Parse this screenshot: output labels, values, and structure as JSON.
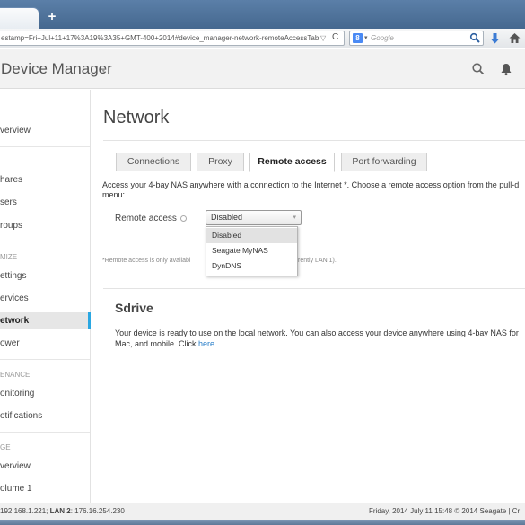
{
  "browser": {
    "newtab_label": "+",
    "url": "estamp=Fri+Jul+11+17%3A19%3A35+GMT-400+2014#device_manager-network-remoteAccessTab",
    "url_dropdown": "▽",
    "reload_glyph": "C",
    "search_engine_badge": "8",
    "search_engine_dropdown": "▾",
    "search_placeholder": "Google",
    "icons": [
      "search-icon",
      "download-icon",
      "home-icon"
    ]
  },
  "header": {
    "title": "Device Manager",
    "title_caret": "▾",
    "icons": [
      "search-icon",
      "bell-icon"
    ],
    "accent_color": "#2aa7e2"
  },
  "sidebar": {
    "items": [
      {
        "label": "verview"
      },
      {
        "label": "hares"
      },
      {
        "label": "sers"
      },
      {
        "label": "roups"
      },
      {
        "label": "ettings"
      },
      {
        "label": "ervices"
      },
      {
        "label": "etwork"
      },
      {
        "label": "ower"
      },
      {
        "label": "onitoring"
      },
      {
        "label": "otifications"
      },
      {
        "label": "verview"
      },
      {
        "label": "olume 1"
      }
    ],
    "section_headings": [
      "MIZE",
      "ENANCE",
      "GE"
    ]
  },
  "main": {
    "title": "Network",
    "tabs": [
      {
        "label": "Connections"
      },
      {
        "label": "Proxy"
      },
      {
        "label": "Remote access"
      },
      {
        "label": "Port forwarding"
      }
    ],
    "description_line1": "Access your 4-bay NAS anywhere with a connection to the Internet *. Choose a remote access option from the pull-d",
    "description_line2": "menu:",
    "remote_access_label": "Remote access",
    "select_value": "Disabled",
    "select_caret": "▾",
    "dropdown_options": [
      {
        "label": "Disabled"
      },
      {
        "label": "Seagate MyNAS"
      },
      {
        "label": "DynDNS"
      }
    ],
    "footnote_left": "*Remote access is only availabl",
    "footnote_right": "rently LAN 1).",
    "sdrive": {
      "title": "Sdrive",
      "line1": "Your device is ready to use on the local network. You can also access your device anywhere using 4-bay NAS for",
      "line2_prefix": "Mac, and mobile. Click ",
      "link": "here"
    }
  },
  "status": {
    "left_prefix": "192.168.1.221; ",
    "lan2_label": "LAN 2",
    "left_suffix": ": 176.16.254.230",
    "right": "Friday, 2014 July 11   15:48   © 2014 Seagate | Cr"
  }
}
